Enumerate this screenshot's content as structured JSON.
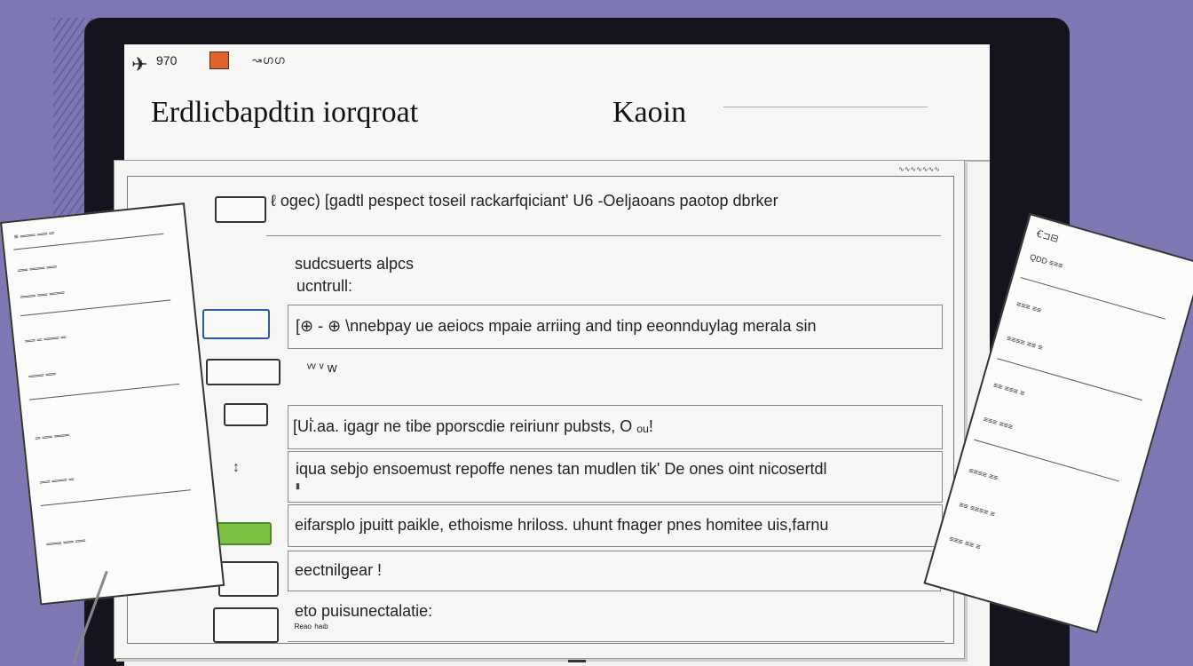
{
  "window": {
    "top_code": "970",
    "top_scribble": "↝ഗഗ",
    "title": "Erdlicbapdtin iorqroat",
    "title_right": "Kaoin",
    "corner_tag": "∿∿∿∿∿∿∿"
  },
  "rows": [
    {
      "text": "ℓ ogec)  [gadtl pespect toseil rackarfqiciant'  U6 -Oeljaoans paotop dbrker"
    },
    {
      "text": "sudcsuerts alpcs"
    },
    {
      "text": "ucntrull:"
    },
    {
      "text": "[⊕ - ⊕ \\nnebpay ue aeiocs  mpaie arriing  and tinp eeonnduylag merala sin"
    },
    {
      "text": "ᵛᵛ ᵛ w"
    },
    {
      "text": "[Ui̇̇.aa. igagr ne tibe pporscdie reiriunr pubsts, O ₒᵤ!"
    },
    {
      "text": "iqua sebjo ensoemust repoffe nenes tan mudlen tik'  De ones oint nicosertdl"
    },
    {
      "text": "eifarsplo jpuitt paikle, ethoisme hriloss. uhunt fnager pnes homitee uis,farnu"
    },
    {
      "text": "eectnilgear !"
    },
    {
      "text": "eto puisunectalatie:"
    },
    {
      "text": "ᴿᵉᵃᵒ ʰᵃᶦᵇ"
    }
  ],
  "left_doc_lines": [
    "≡ ═══ ══ ═",
    "══ ═══ ══",
    "═══ ══ ═══",
    "══ ═ ═══ ═",
    "═══ ══",
    "═ ══ ═══",
    "══ ═══ ═",
    "═══ ══ ══"
  ],
  "right_doc_lines": [
    "Ꞓ⊐⊟",
    "QDD ≡≡≡",
    "≡≡≡ ≡≡",
    "≡≡≡≡ ≡≡ ≡",
    "≡≡ ≡≡≡ ≡",
    "≡≡≡ ≡≡≡",
    "≡≡≡≡ ≡≡",
    "≡≡ ≡≡≡≡ ≡",
    "≡≡≡ ≡≡ ≡"
  ]
}
